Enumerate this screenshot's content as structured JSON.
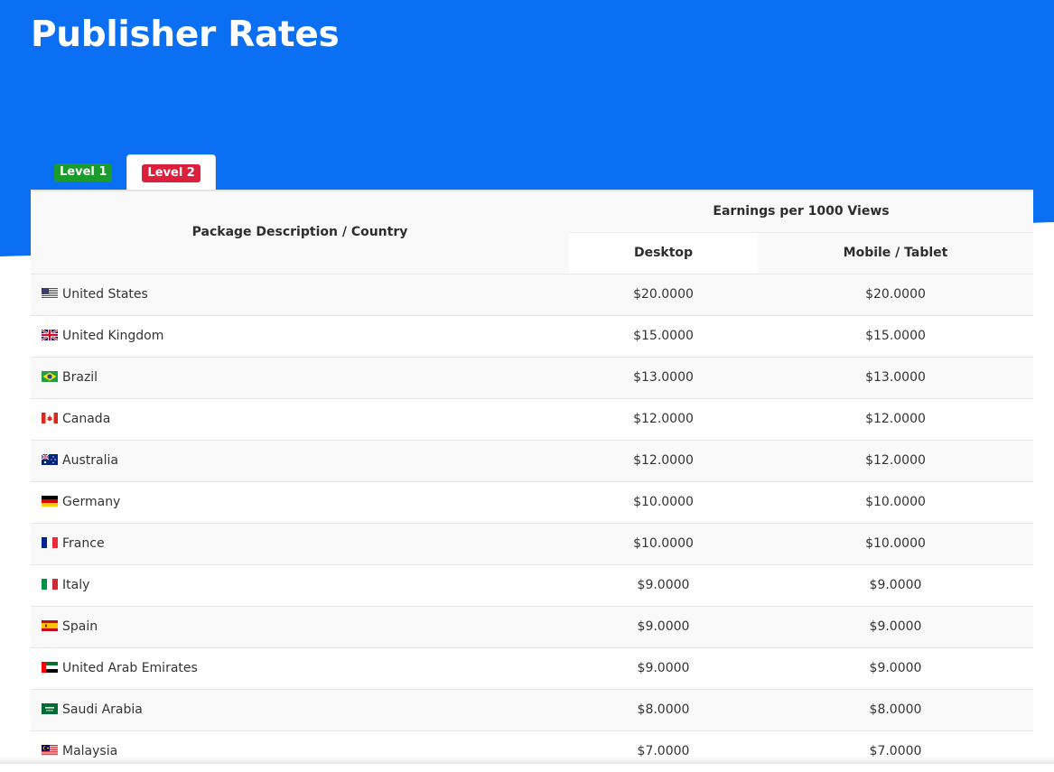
{
  "page": {
    "title": "Publisher Rates",
    "accent": "#0a6ff3"
  },
  "tabs": [
    {
      "label": "Level 1",
      "color": "#1a9b2c",
      "active": false
    },
    {
      "label": "Level 2",
      "color": "#dc1f3a",
      "active": true
    }
  ],
  "table": {
    "header_country": "Package Description / Country",
    "header_earnings": "Earnings per 1000 Views",
    "header_desktop": "Desktop",
    "header_mobile": "Mobile / Tablet",
    "rows": [
      {
        "flag": "us-flag-icon",
        "country": "United States",
        "desktop": "$20.0000",
        "mobile": "$20.0000"
      },
      {
        "flag": "gb-flag-icon",
        "country": "United Kingdom",
        "desktop": "$15.0000",
        "mobile": "$15.0000"
      },
      {
        "flag": "br-flag-icon",
        "country": "Brazil",
        "desktop": "$13.0000",
        "mobile": "$13.0000"
      },
      {
        "flag": "ca-flag-icon",
        "country": "Canada",
        "desktop": "$12.0000",
        "mobile": "$12.0000"
      },
      {
        "flag": "au-flag-icon",
        "country": "Australia",
        "desktop": "$12.0000",
        "mobile": "$12.0000"
      },
      {
        "flag": "de-flag-icon",
        "country": "Germany",
        "desktop": "$10.0000",
        "mobile": "$10.0000"
      },
      {
        "flag": "fr-flag-icon",
        "country": "France",
        "desktop": "$10.0000",
        "mobile": "$10.0000"
      },
      {
        "flag": "it-flag-icon",
        "country": "Italy",
        "desktop": "$9.0000",
        "mobile": "$9.0000"
      },
      {
        "flag": "es-flag-icon",
        "country": "Spain",
        "desktop": "$9.0000",
        "mobile": "$9.0000"
      },
      {
        "flag": "ae-flag-icon",
        "country": "United Arab Emirates",
        "desktop": "$9.0000",
        "mobile": "$9.0000"
      },
      {
        "flag": "sa-flag-icon",
        "country": "Saudi Arabia",
        "desktop": "$8.0000",
        "mobile": "$8.0000"
      },
      {
        "flag": "my-flag-icon",
        "country": "Malaysia",
        "desktop": "$7.0000",
        "mobile": "$7.0000"
      }
    ]
  }
}
